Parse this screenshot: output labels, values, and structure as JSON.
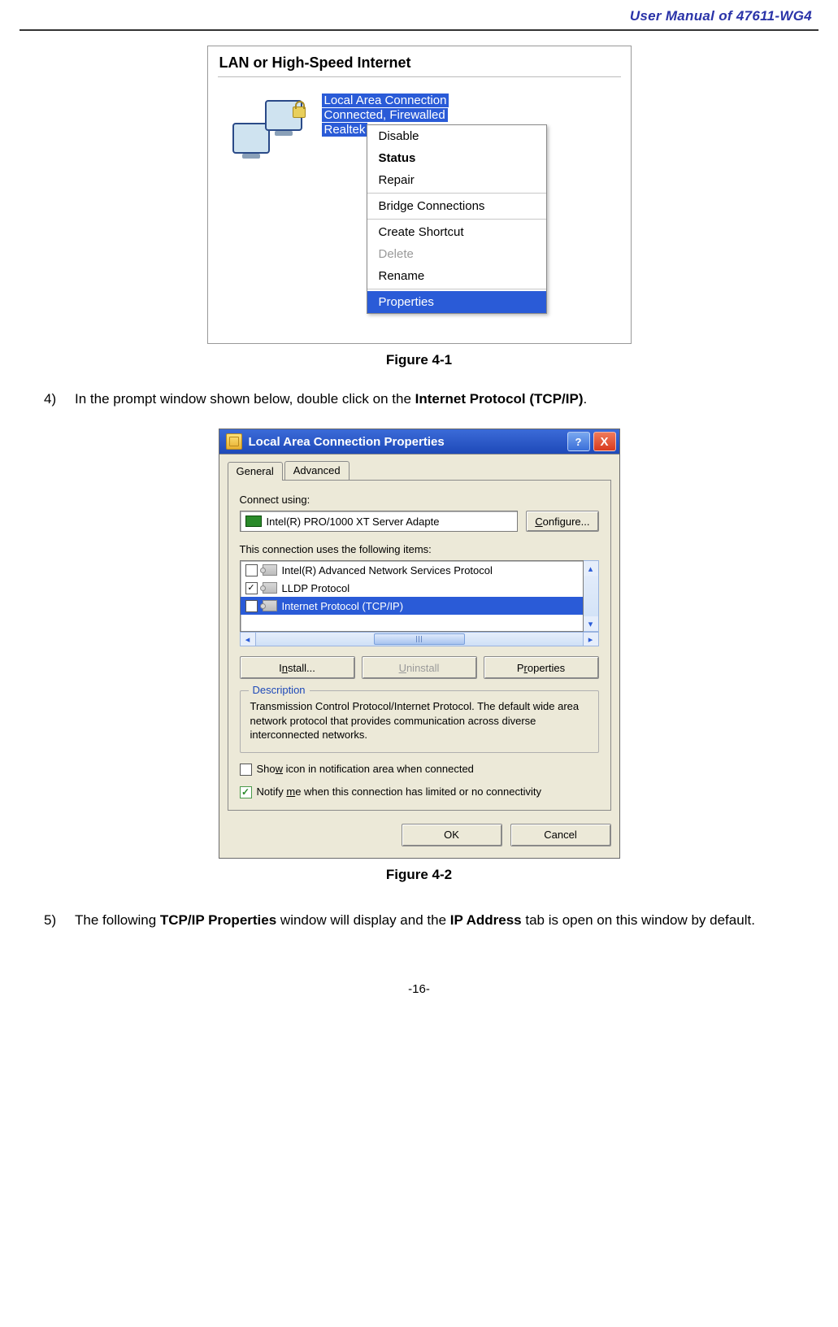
{
  "header": {
    "title": "User Manual of 47611-WG4"
  },
  "fig1": {
    "panel_title": "LAN or High-Speed Internet",
    "conn": {
      "name": "Local Area Connection",
      "status": "Connected, Firewalled",
      "adapter": "Realtek"
    },
    "menu": {
      "disable": "Disable",
      "status": "Status",
      "repair": "Repair",
      "bridge": "Bridge Connections",
      "shortcut": "Create Shortcut",
      "delete": "Delete",
      "rename": "Rename",
      "properties": "Properties"
    },
    "caption": "Figure 4-1"
  },
  "step4": {
    "num": "4)",
    "t1": "In the prompt window shown below, double click on the ",
    "bold": "Internet Protocol (TCP/IP)",
    "t2": "."
  },
  "fig2": {
    "title": "Local Area Connection Properties",
    "help": "?",
    "close": "X",
    "tabs": {
      "general": "General",
      "advanced": "Advanced"
    },
    "connect_using_label": "Connect using:",
    "adapter": "Intel(R) PRO/1000 XT Server Adapte",
    "configure": "Configure...",
    "items_label": "This connection uses the following items:",
    "items": {
      "a": "Intel(R) Advanced Network Services Protocol",
      "b": "LLDP Protocol",
      "c": "Internet Protocol (TCP/IP)"
    },
    "install": "Install...",
    "uninstall": "Uninstall",
    "properties": "Properties",
    "desc_legend": "Description",
    "desc_text": "Transmission Control Protocol/Internet Protocol. The default wide area network protocol that provides communication across diverse interconnected networks.",
    "chk_show": "Show icon in notification area when connected",
    "chk_notify": "Notify me when this connection has limited or no connectivity",
    "ok": "OK",
    "cancel": "Cancel",
    "caption": "Figure 4-2"
  },
  "step5": {
    "num": "5)",
    "t1": "The following ",
    "b1": "TCP/IP Properties",
    "t2": " window will display and the ",
    "b2": "IP Address",
    "t3": " tab is open on this window by default."
  },
  "footer": {
    "page": "-16-"
  }
}
